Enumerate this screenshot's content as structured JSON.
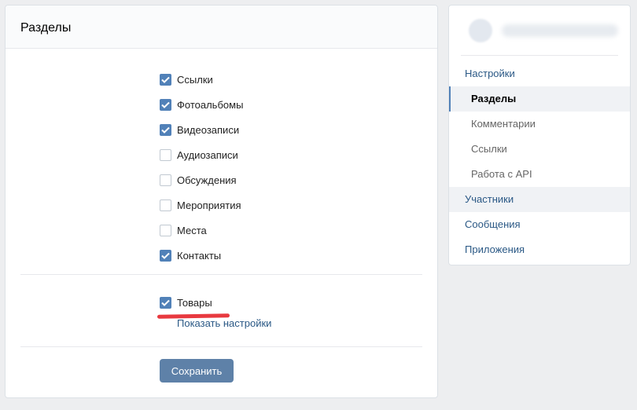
{
  "panel": {
    "title": "Разделы",
    "checkboxes": [
      {
        "label": "Ссылки",
        "checked": true
      },
      {
        "label": "Фотоальбомы",
        "checked": true
      },
      {
        "label": "Видеозаписи",
        "checked": true
      },
      {
        "label": "Аудиозаписи",
        "checked": false
      },
      {
        "label": "Обсуждения",
        "checked": false
      },
      {
        "label": "Мероприятия",
        "checked": false
      },
      {
        "label": "Места",
        "checked": false
      },
      {
        "label": "Контакты",
        "checked": true
      }
    ],
    "goods": {
      "label": "Товары",
      "checked": true
    },
    "show_settings": "Показать настройки",
    "save_label": "Сохранить"
  },
  "sidebar": {
    "items": [
      {
        "label": "Настройки"
      },
      {
        "label": "Разделы"
      },
      {
        "label": "Комментарии"
      },
      {
        "label": "Ссылки"
      },
      {
        "label": "Работа с API"
      },
      {
        "label": "Участники"
      },
      {
        "label": "Сообщения"
      },
      {
        "label": "Приложения"
      }
    ]
  },
  "colors": {
    "accent": "#5181b8",
    "link": "#2a5885",
    "button": "#5e81a8",
    "highlight": "#e8393f"
  }
}
